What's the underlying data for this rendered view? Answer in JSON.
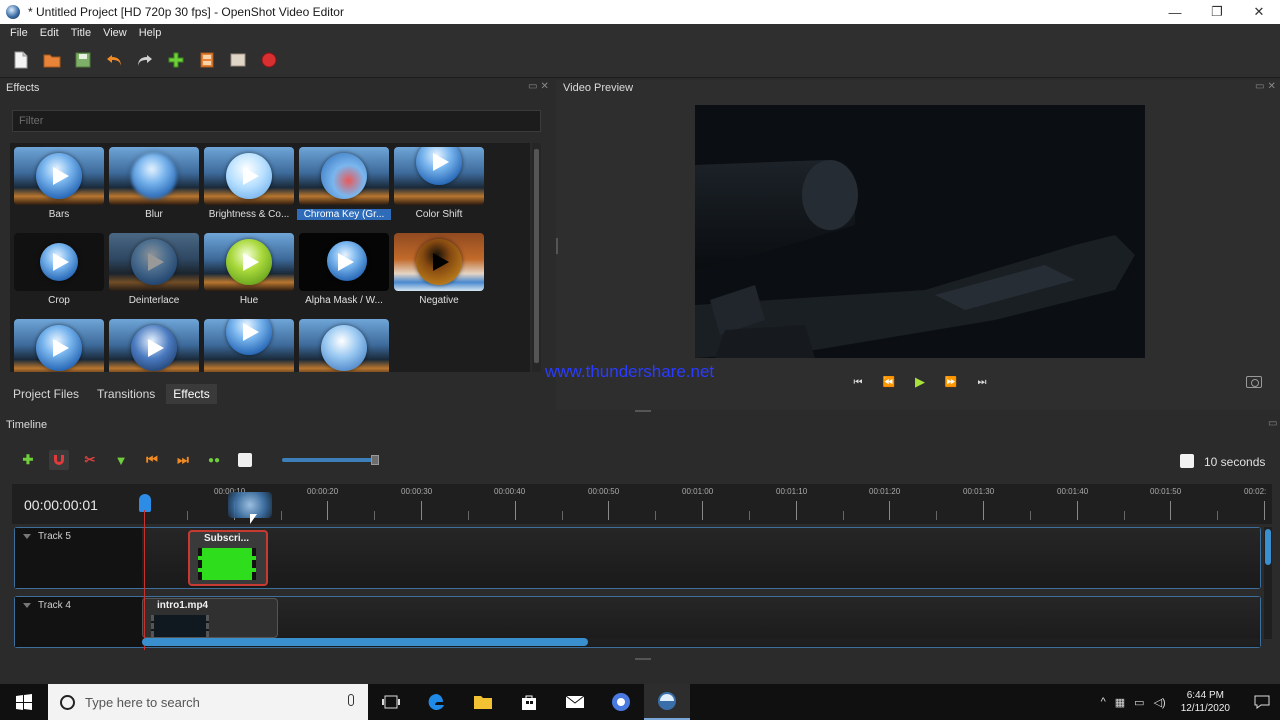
{
  "window": {
    "title": "* Untitled Project [HD 720p 30 fps] - OpenShot Video Editor",
    "controls": [
      "—",
      "❐",
      "✕"
    ]
  },
  "menu": [
    "File",
    "Edit",
    "Title",
    "View",
    "Help"
  ],
  "effects_panel": {
    "title": "Effects",
    "filter_placeholder": "Filter",
    "items": [
      {
        "label": "Bars"
      },
      {
        "label": "Blur"
      },
      {
        "label": "Brightness & Co..."
      },
      {
        "label": "Chroma Key (Gr...",
        "selected": true
      },
      {
        "label": "Color Shift"
      },
      {
        "label": "Crop"
      },
      {
        "label": "Deinterlace"
      },
      {
        "label": "Hue"
      },
      {
        "label": "Alpha Mask / W..."
      },
      {
        "label": "Negative"
      },
      {
        "label": ""
      },
      {
        "label": ""
      },
      {
        "label": ""
      },
      {
        "label": ""
      }
    ]
  },
  "tabs": [
    {
      "label": "Project Files"
    },
    {
      "label": "Transitions"
    },
    {
      "label": "Effects",
      "active": true
    }
  ],
  "preview": {
    "title": "Video Preview",
    "watermark": "www.thundershare.net"
  },
  "timeline": {
    "title": "Timeline",
    "timecode": "00:00:00:01",
    "zoom_label": "10 seconds",
    "ruler_labels": [
      "00:00:10",
      "00:00:20",
      "00:00:30",
      "00:00:40",
      "00:00:50",
      "00:01:00",
      "00:01:10",
      "00:01:20",
      "00:01:30",
      "00:01:40",
      "00:01:50",
      "00:02:"
    ],
    "tracks": [
      {
        "name": "Track 5",
        "clip": "Subscri..."
      },
      {
        "name": "Track 4",
        "clip": "intro1.mp4"
      }
    ]
  },
  "taskbar": {
    "search_placeholder": "Type here to search",
    "time": "6:44 PM",
    "date": "12/11/2020"
  },
  "colors": {
    "accent": "#3a8fcf",
    "selection": "#2e6bb8",
    "play_green": "#a8e23a",
    "record_red": "#d83030",
    "watermark_blue": "#2a3cff",
    "chroma_green": "#2ede1c"
  }
}
